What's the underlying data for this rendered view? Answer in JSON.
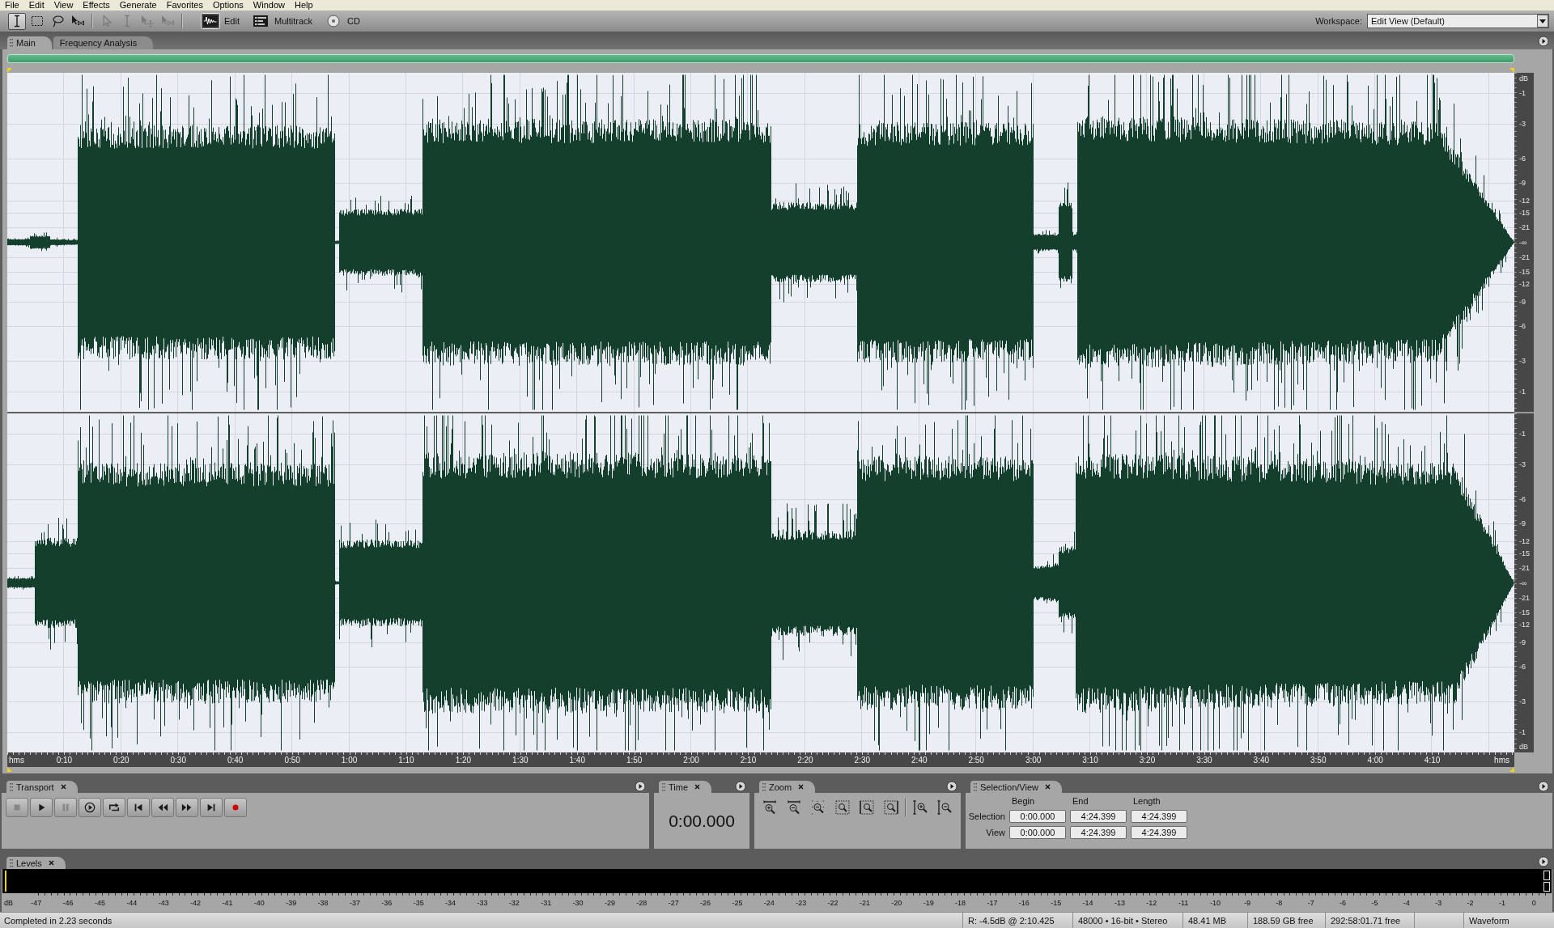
{
  "menu_bar": {
    "items": [
      "File",
      "Edit",
      "View",
      "Effects",
      "Generate",
      "Favorites",
      "Options",
      "Window",
      "Help"
    ]
  },
  "toolbar": {
    "tool_groups": [
      {
        "tools": [
          {
            "kind": "ibeam",
            "selected": true,
            "disabled": false
          },
          {
            "kind": "marquee",
            "selected": false,
            "disabled": false
          },
          {
            "kind": "lasso",
            "selected": false,
            "disabled": false
          },
          {
            "kind": "hybrid",
            "selected": false,
            "disabled": false
          }
        ]
      },
      {
        "tools": [
          {
            "kind": "arrow",
            "selected": false,
            "disabled": true
          },
          {
            "kind": "ibeam",
            "selected": false,
            "disabled": true
          },
          {
            "kind": "move",
            "selected": false,
            "disabled": true
          },
          {
            "kind": "hybrid",
            "selected": false,
            "disabled": true
          }
        ]
      }
    ],
    "views": [
      {
        "kind": "edit",
        "label": "Edit",
        "selected": true
      },
      {
        "kind": "multitrack",
        "label": "Multitrack",
        "selected": false
      },
      {
        "kind": "cd",
        "label": "CD",
        "selected": false
      }
    ],
    "workspace": {
      "label": "Workspace:",
      "value": "Edit View (Default)"
    }
  },
  "main_panel": {
    "tabs": [
      {
        "label": "Main",
        "selected": true
      },
      {
        "label": "Frequency Analysis",
        "selected": false
      }
    ],
    "waveform": {
      "scale_unit_top": "dB",
      "channels": [
        {
          "scale_labels": [
            "-1",
            "-3",
            "-6",
            "-9",
            "-12",
            "-15",
            "-21",
            "-∞",
            "-21",
            "-15",
            "-12",
            "-9",
            "-6",
            "-3",
            "-1"
          ]
        },
        {
          "scale_labels": [
            "-1",
            "-3",
            "-6",
            "-9",
            "-12",
            "-15",
            "-21",
            "-∞",
            "-21",
            "-15",
            "-12",
            "-9",
            "-6",
            "-3",
            "-1"
          ]
        }
      ],
      "scale_unit_bottom": "dB"
    },
    "ruler": {
      "unit_start": "hms",
      "labels": [
        "0:10",
        "0:20",
        "0:30",
        "0:40",
        "0:50",
        "1:00",
        "1:10",
        "1:20",
        "1:30",
        "1:40",
        "1:50",
        "2:00",
        "2:10",
        "2:20",
        "2:30",
        "2:40",
        "2:50",
        "3:00",
        "3:10",
        "3:20",
        "3:30",
        "3:40",
        "3:50",
        "4:00",
        "4:10"
      ],
      "unit_end": "hms"
    }
  },
  "transport_panel": {
    "title": "Transport",
    "buttons": [
      {
        "kind": "stop",
        "disabled": true
      },
      {
        "kind": "play",
        "disabled": false
      },
      {
        "kind": "pause",
        "disabled": true
      },
      {
        "kind": "playcursor",
        "disabled": false
      },
      {
        "kind": "loop",
        "disabled": false
      },
      {
        "kind": "start",
        "disabled": false
      },
      {
        "kind": "rewind",
        "disabled": false
      },
      {
        "kind": "forward",
        "disabled": false
      },
      {
        "kind": "end",
        "disabled": false
      },
      {
        "kind": "record",
        "disabled": false
      }
    ]
  },
  "time_panel": {
    "title": "Time",
    "value": "0:00.000"
  },
  "zoom_panel": {
    "title": "Zoom",
    "button_groups": [
      {
        "buttons": [
          {
            "kind": "in"
          },
          {
            "kind": "out"
          },
          {
            "kind": "full"
          },
          {
            "kind": "selection"
          },
          {
            "kind": "left"
          },
          {
            "kind": "right"
          }
        ]
      },
      {
        "buttons": [
          {
            "kind": "vin"
          },
          {
            "kind": "vout"
          }
        ]
      }
    ]
  },
  "selection_view_panel": {
    "title": "Selection/View",
    "columns": [
      "Begin",
      "End",
      "Length"
    ],
    "rows": [
      {
        "label": "Selection",
        "values": [
          "0:00.000",
          "4:24.399",
          "4:24.399"
        ]
      },
      {
        "label": "View",
        "values": [
          "0:00.000",
          "4:24.399",
          "4:24.399"
        ]
      }
    ]
  },
  "levels_panel": {
    "title": "Levels",
    "unit": "dB",
    "ticks": [
      "-47",
      "-46",
      "-45",
      "-44",
      "-43",
      "-42",
      "-41",
      "-40",
      "-39",
      "-38",
      "-37",
      "-36",
      "-35",
      "-34",
      "-33",
      "-32",
      "-31",
      "-30",
      "-29",
      "-28",
      "-27",
      "-26",
      "-25",
      "-24",
      "-23",
      "-22",
      "-21",
      "-20",
      "-19",
      "-18",
      "-17",
      "-16",
      "-15",
      "-14",
      "-13",
      "-12",
      "-11",
      "-10",
      "-9",
      "-8",
      "-7",
      "-6",
      "-5",
      "-4",
      "-3",
      "-2",
      "-1",
      "0"
    ]
  },
  "status_bar": {
    "message": "Completed in 2.23 seconds",
    "cells": [
      "R: -4.5dB @ 2:10.425",
      "48000 • 16-bit • Stereo",
      "48.41 MB",
      "188.59 GB free",
      "292:58:01.71 free"
    ],
    "view_mode": "Waveform"
  }
}
